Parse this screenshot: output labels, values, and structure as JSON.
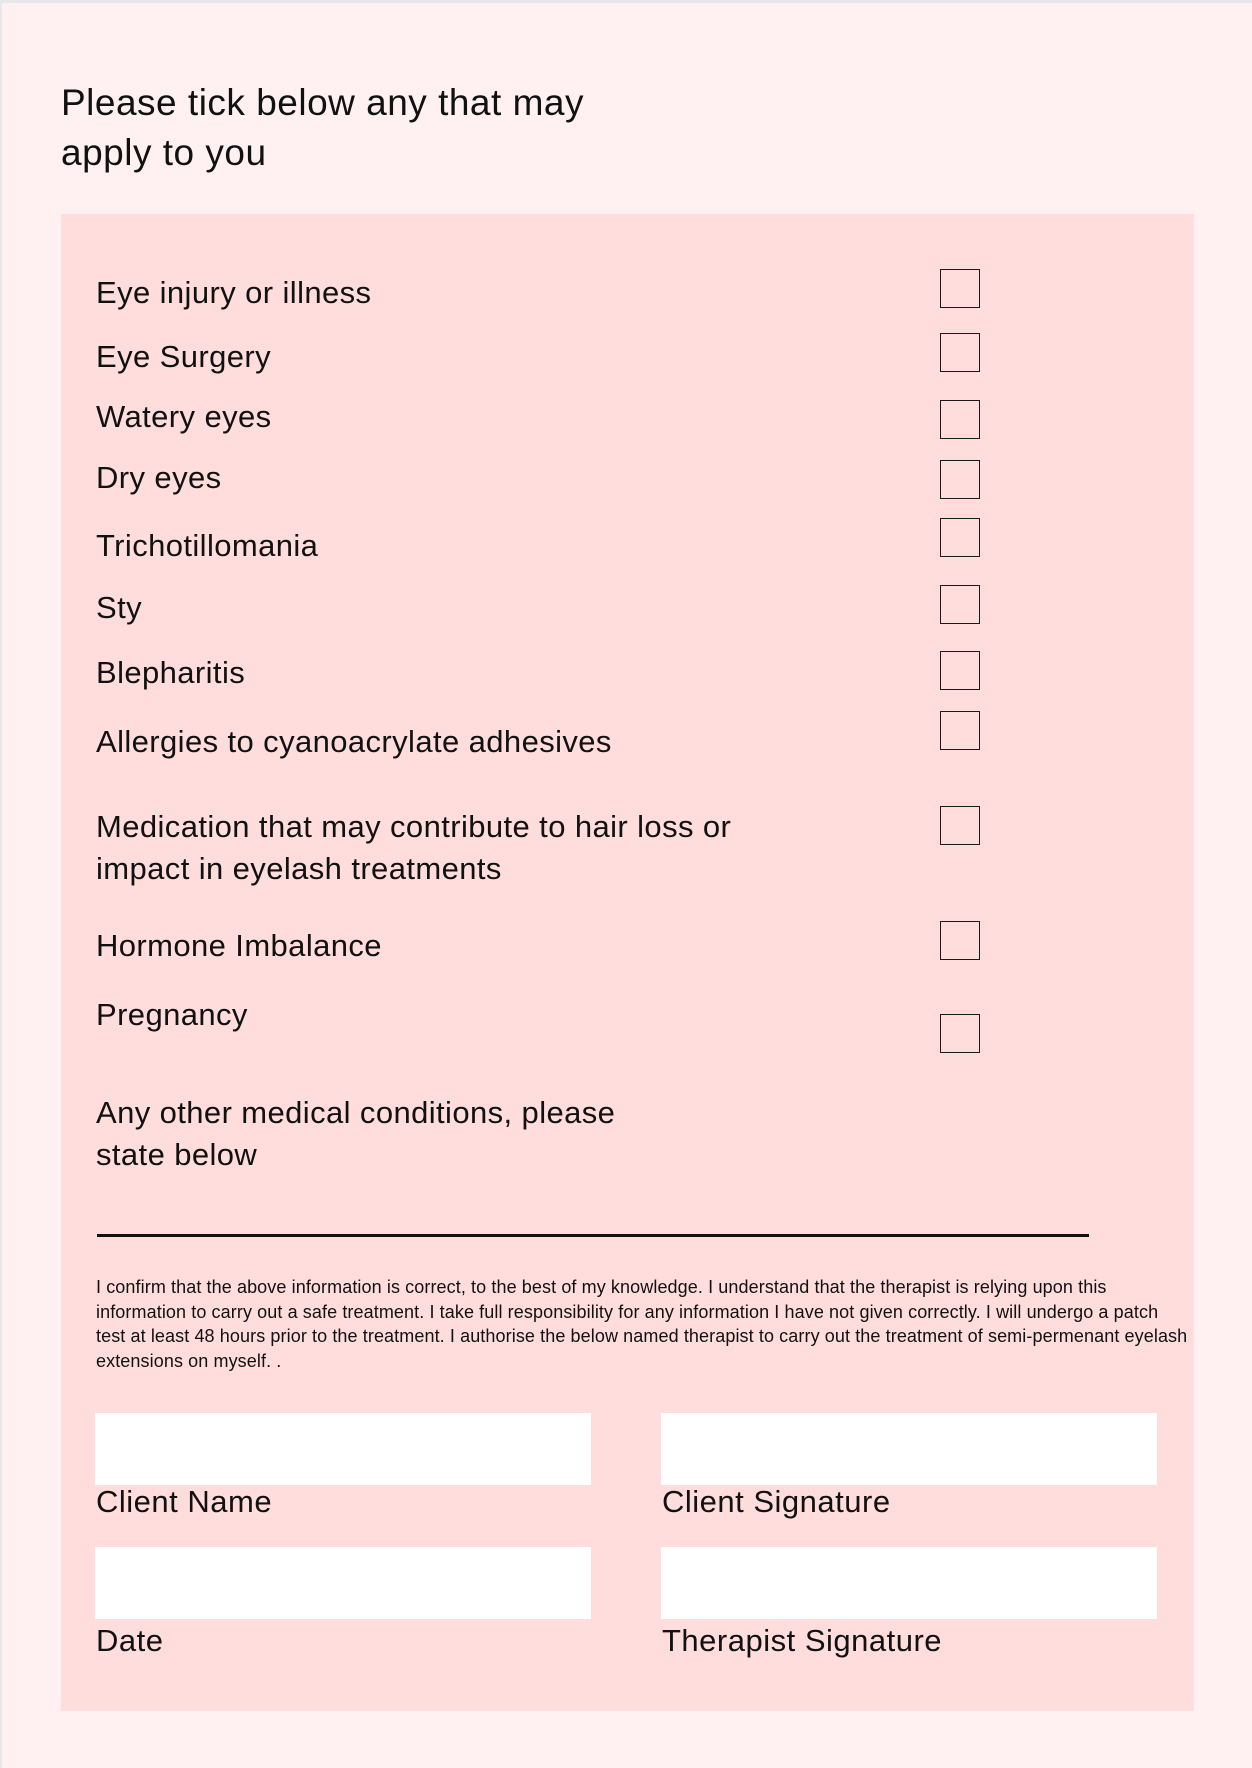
{
  "page": {
    "title": "Please tick below any that may apply to you",
    "title_lines": [
      "Please tick below any that may",
      "apply to you"
    ]
  },
  "conditions": {
    "items": [
      {
        "label": "Eye injury or illness",
        "checked": false
      },
      {
        "label": "Eye Surgery",
        "checked": false
      },
      {
        "label": "Watery eyes",
        "checked": false
      },
      {
        "label": "Dry eyes",
        "checked": false
      },
      {
        "label": "Trichotillomania",
        "checked": false
      },
      {
        "label": "Sty",
        "checked": false
      },
      {
        "label": "Blepharitis",
        "checked": false
      },
      {
        "label": "Allergies to cyanoacrylate adhesives",
        "checked": false
      },
      {
        "label": "Medication that may contribute to hair loss or impact in eyelash treatments",
        "lines": [
          "Medication that may contribute to hair loss or",
          "impact in eyelash treatments"
        ],
        "checked": false
      },
      {
        "label": "Hormone Imbalance",
        "checked": false
      },
      {
        "label": "Pregnancy",
        "checked": false
      }
    ],
    "other_prompt_lines": [
      "Any other medical conditions, please",
      "state below"
    ],
    "other_value": ""
  },
  "disclaimer": "I confirm that the above information is correct, to the best of my knowledge. I understand that the therapist is relying upon this information to carry out a safe treatment. I take full responsibility for any information I have not given correctly. I will undergo a patch test at least 48 hours prior to the treatment. I authorise the below named therapist to carry out the treatment of semi-permenant eyelash extensions on myself. .",
  "signature_fields": {
    "client_name": {
      "label": "Client Name",
      "value": ""
    },
    "client_signature": {
      "label": "Client Signature",
      "value": ""
    },
    "date": {
      "label": "Date",
      "value": ""
    },
    "therapist_signature": {
      "label": "Therapist Signature",
      "value": ""
    }
  },
  "colors": {
    "page_background": "#fff0f1",
    "panel_background": "#fedddc",
    "field_background": "#ffffff",
    "text": "#111111"
  }
}
